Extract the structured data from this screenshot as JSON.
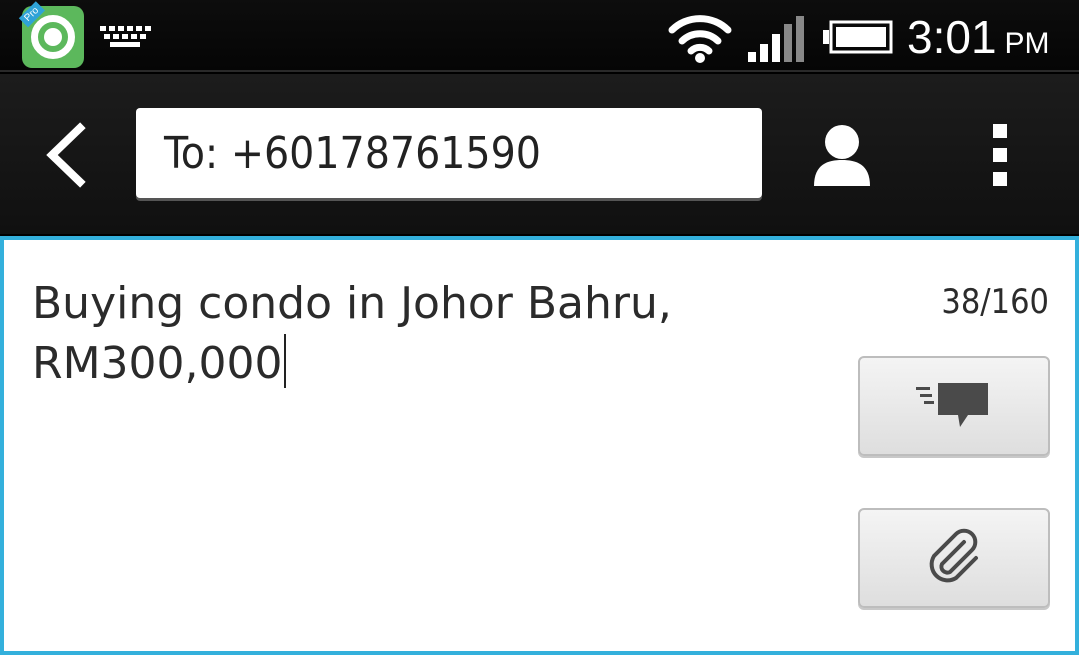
{
  "status_bar": {
    "time": "3:01",
    "ampm": "PM",
    "app_badge": "Pro",
    "icons": [
      "app-icon",
      "keyboard-icon",
      "wifi-icon",
      "signal-icon",
      "battery-icon"
    ]
  },
  "header": {
    "to_field_text": "To: +60178761590",
    "icons": [
      "back-arrow-icon",
      "contact-person-icon",
      "overflow-menu-icon"
    ]
  },
  "compose": {
    "message_text": "Buying condo in Johor Bahru,\nRM300,000",
    "char_counter": "38/160",
    "accent_color": "#33b0dc",
    "buttons": [
      {
        "name": "send-button",
        "icon": "send-message-icon"
      },
      {
        "name": "attach-button",
        "icon": "paperclip-icon"
      }
    ]
  }
}
